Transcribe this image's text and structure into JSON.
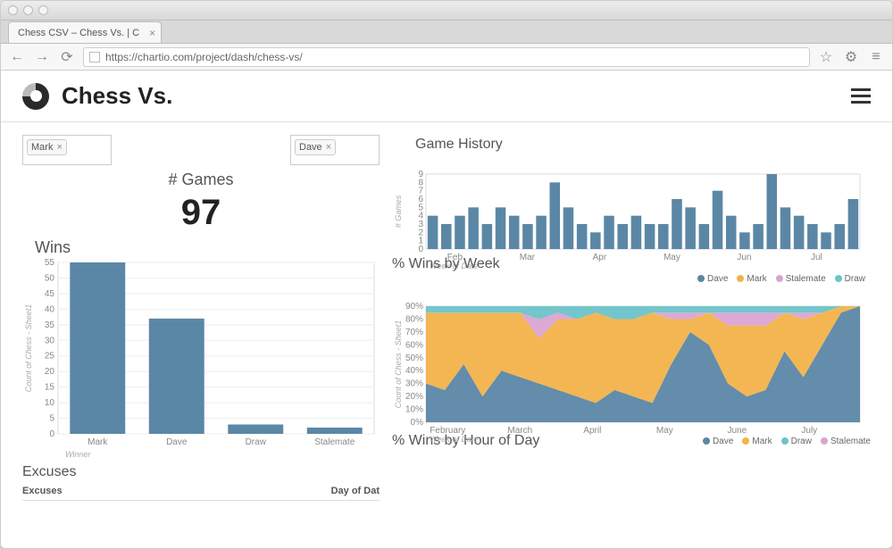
{
  "browser": {
    "tab_title": "Chess CSV – Chess Vs. | C",
    "url": "https://chartio.com/project/dash/chess-vs/"
  },
  "header": {
    "title": "Chess Vs."
  },
  "filters": {
    "left": "Mark",
    "right": "Dave"
  },
  "kpi": {
    "label": "# Games",
    "value": "97"
  },
  "wins_chart": {
    "title": "Wins",
    "y_axis_title": "Count of Chess - Sheet1",
    "x_axis_title": "Winner"
  },
  "game_history": {
    "title": "Game History",
    "y_axis_title": "# Games",
    "x_axis_title": "Week of Date"
  },
  "wins_by_week": {
    "title": "% Wins by Week",
    "y_axis_title": "Count of Chess - Sheet1",
    "x_axis_title": "Week of Date",
    "legend": [
      "Dave",
      "Mark",
      "Stalemate",
      "Draw"
    ]
  },
  "wins_by_hour": {
    "title": "% Wins by Hour of Day",
    "legend": [
      "Dave",
      "Mark",
      "Draw",
      "Stalemate"
    ]
  },
  "excuses": {
    "title": "Excuses",
    "col1": "Excuses",
    "col2": "Day of Dat"
  },
  "colors": {
    "dave": "#5b87a6",
    "mark": "#f2b24a",
    "stalemate": "#d9a4d2",
    "draw": "#6cc3c9"
  },
  "chart_data": [
    {
      "id": "wins",
      "type": "bar",
      "title": "Wins",
      "xlabel": "Winner",
      "ylabel": "Count of Chess - Sheet1",
      "ylim": [
        0,
        55
      ],
      "yticks": [
        0,
        5,
        10,
        15,
        20,
        25,
        30,
        35,
        40,
        45,
        50,
        55
      ],
      "categories": [
        "Mark",
        "Dave",
        "Draw",
        "Stalemate"
      ],
      "values": [
        55,
        37,
        3,
        2
      ]
    },
    {
      "id": "game_history",
      "type": "bar",
      "title": "Game History",
      "xlabel": "Week of Date",
      "ylabel": "# Games",
      "ylim": [
        0,
        9
      ],
      "yticks": [
        0,
        1,
        2,
        3,
        4,
        5,
        6,
        7,
        8,
        9
      ],
      "x_month_labels": [
        "Feb",
        "Mar",
        "Apr",
        "May",
        "Jun",
        "Jul"
      ],
      "values": [
        4,
        3,
        4,
        5,
        3,
        5,
        4,
        3,
        4,
        8,
        5,
        3,
        2,
        4,
        3,
        4,
        3,
        3,
        6,
        5,
        3,
        7,
        4,
        2,
        3,
        9,
        5,
        4,
        3,
        2,
        3,
        6
      ]
    },
    {
      "id": "wins_by_week",
      "type": "area",
      "stacked": true,
      "title": "% Wins by Week",
      "xlabel": "Week of Date",
      "ylabel": "Count of Chess - Sheet1",
      "ylim": [
        0,
        90
      ],
      "yticks": [
        0,
        10,
        20,
        30,
        40,
        50,
        60,
        70,
        80,
        90
      ],
      "x_month_labels": [
        "February",
        "March",
        "April",
        "May",
        "June",
        "July"
      ],
      "legend": [
        "Dave",
        "Mark",
        "Stalemate",
        "Draw"
      ],
      "series": [
        {
          "name": "Dave",
          "color": "#5b87a6",
          "values": [
            30,
            25,
            45,
            20,
            40,
            35,
            30,
            25,
            20,
            15,
            25,
            20,
            15,
            45,
            70,
            60,
            30,
            20,
            25,
            55,
            35,
            60,
            85,
            90
          ]
        },
        {
          "name": "Mark",
          "color": "#f2b24a",
          "values": [
            55,
            60,
            40,
            65,
            45,
            50,
            35,
            55,
            60,
            70,
            55,
            60,
            70,
            35,
            10,
            25,
            45,
            55,
            50,
            30,
            45,
            25,
            5,
            0
          ]
        },
        {
          "name": "Stalemate",
          "color": "#d9a4d2",
          "values": [
            0,
            0,
            0,
            0,
            0,
            0,
            15,
            5,
            0,
            0,
            0,
            0,
            0,
            5,
            5,
            0,
            10,
            10,
            10,
            0,
            5,
            0,
            0,
            0
          ]
        },
        {
          "name": "Draw",
          "color": "#6cc3c9",
          "values": [
            5,
            5,
            5,
            5,
            5,
            5,
            10,
            5,
            10,
            5,
            10,
            10,
            5,
            5,
            5,
            5,
            5,
            5,
            5,
            5,
            5,
            5,
            0,
            0
          ]
        }
      ]
    }
  ]
}
